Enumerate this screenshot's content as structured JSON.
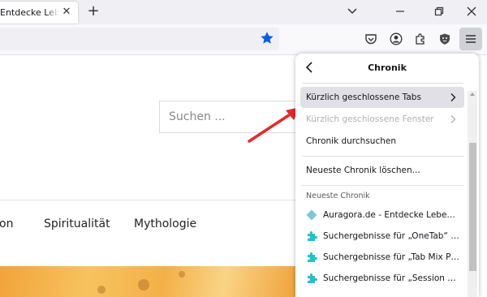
{
  "browser": {
    "tab_title": "Entdecke Lebensmysterien",
    "tab_close": "✕",
    "new_tab": "+"
  },
  "page": {
    "search_placeholder": "Suchen ...",
    "nav_items": [
      "on",
      "Spiritualität",
      "Mythologie"
    ]
  },
  "panel": {
    "title": "Chronik",
    "items": [
      {
        "label": "Kürzlich geschlossene Tabs",
        "state": "hover"
      },
      {
        "label": "Kürzlich geschlossene Fenster",
        "state": "disabled"
      },
      {
        "label": "Chronik durchsuchen",
        "state": "normal"
      },
      {
        "label": "Neueste Chronik löschen...",
        "state": "normal"
      }
    ],
    "section_label": "Neueste Chronik",
    "history": [
      {
        "title": "Auragora.de - Entdecke Lebensmysterien",
        "icon": "diamond-icon"
      },
      {
        "title": "Suchergebnisse für „OneTab“ – Add-ons für Firefox",
        "icon": "puzzle-icon"
      },
      {
        "title": "Suchergebnisse für „Tab Mix Plus“ – Add-ons für Firefox",
        "icon": "puzzle-icon"
      },
      {
        "title": "Suchergebnisse für „Session Manager“ – Add-ons für Firefox",
        "icon": "puzzle-icon"
      }
    ]
  },
  "colors": {
    "star": "#0060df",
    "arrow": "#e8272a",
    "addon_icon": "#20c3cc",
    "site_icon": "#7cc9d6"
  }
}
